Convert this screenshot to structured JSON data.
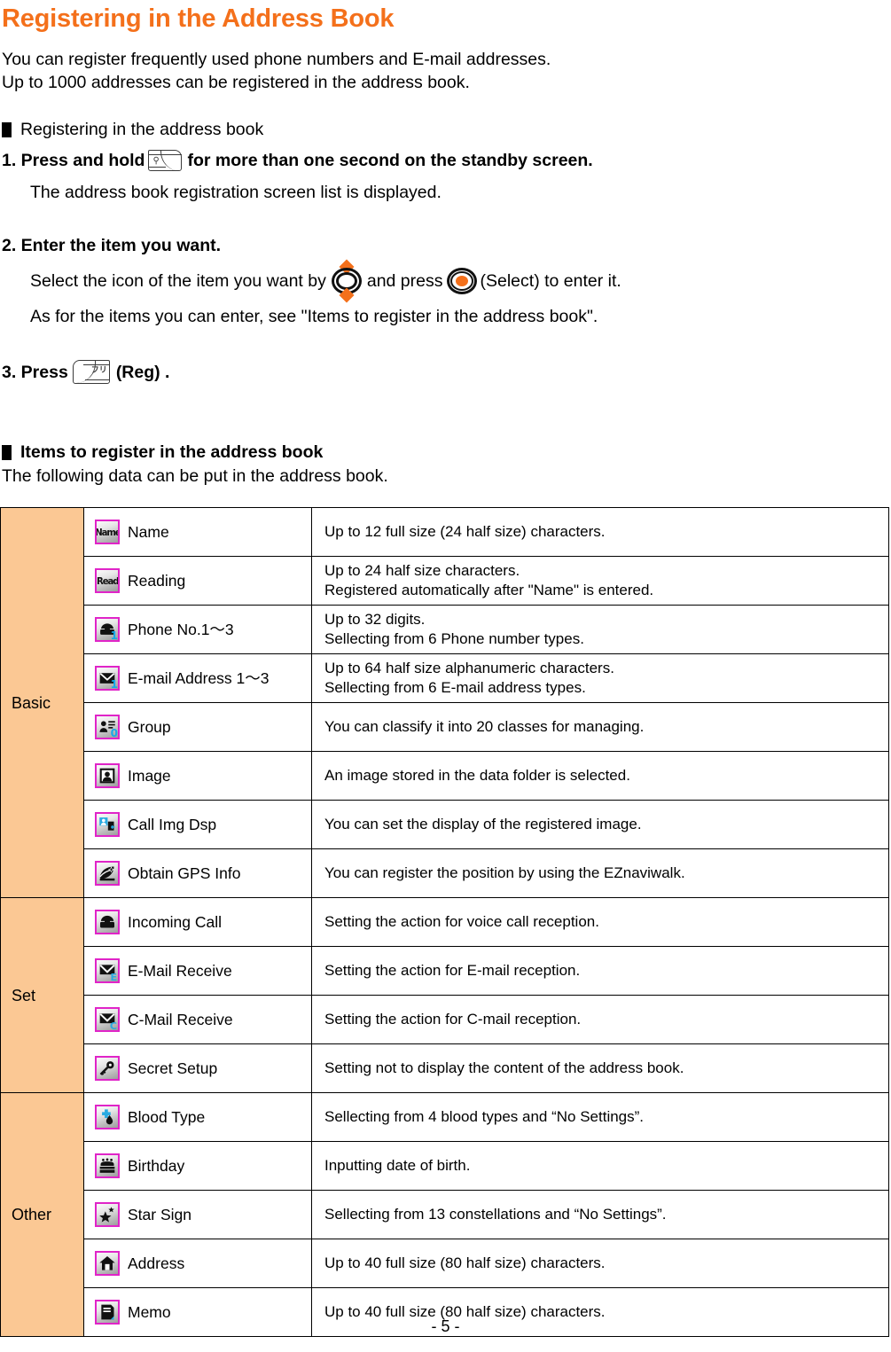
{
  "title": "Registering in the Address Book",
  "intro": {
    "line1": "You can register frequently used phone numbers and E-mail addresses.",
    "line2": "Up to 1000 addresses can be registered in the address book."
  },
  "section1": {
    "heading": "Registering in the address book",
    "step1": {
      "prefix": "1. Press and hold",
      "key_icon": "address-book-key-icon",
      "suffix": "for more than one second on the standby screen.",
      "note": "The address book registration screen list is displayed."
    },
    "step2": {
      "heading": "2. Enter the item you want.",
      "note1_a": "Select the icon of the item you want by",
      "note1_b": "and press",
      "note1_c": "(Select) to enter it.",
      "nav_icon": "navigation-key-icon",
      "select_icon": "select-key-icon",
      "note2": "As for the items you can enter, see \"Items to register in the address book\"."
    },
    "step3": {
      "prefix": "3. Press",
      "key_icon": "reg-soft-key-icon",
      "suffix": "(Reg) ."
    }
  },
  "section2": {
    "heading": "Items to register in the address book",
    "lead": "The following data can be put in the address book."
  },
  "table": {
    "accent_color": "#FBC894",
    "icon_border_color": "#E024C8",
    "groups": [
      {
        "category": "Basic",
        "rows": [
          {
            "icon": "name-text-icon",
            "icon_text": "Name",
            "label": "Name",
            "desc": [
              "Up to 12 full size (24 half size) characters."
            ]
          },
          {
            "icon": "reading-text-icon",
            "icon_text": "Read",
            "label": "Reading",
            "desc": [
              "Up to 24 half size characters.",
              "Registered automatically after \"Name\" is entered."
            ]
          },
          {
            "icon": "telephone-icon",
            "badge": "1",
            "label": "Phone No.1～3",
            "desc": [
              "Up to 32 digits.",
              "Sellecting from 6 Phone number types."
            ]
          },
          {
            "icon": "envelope-icon",
            "badge": "1",
            "label": "E-mail Address 1～3",
            "desc": [
              "Up to 64 half size alphanumeric characters.",
              "Sellecting from 6 E-mail address types."
            ]
          },
          {
            "icon": "group-person-list-icon",
            "badge": "0",
            "label": "Group",
            "desc": [
              "You can classify it into 20 classes for managing."
            ]
          },
          {
            "icon": "portrait-image-icon",
            "label": "Image",
            "desc": [
              "An image stored in the data folder is selected."
            ]
          },
          {
            "icon": "call-image-display-icon",
            "label": "Call Img Dsp",
            "desc": [
              "You can set the display of the registered image."
            ]
          },
          {
            "icon": "gps-location-icon",
            "label": "Obtain GPS Info",
            "desc": [
              "You can register the position by using the EZnaviwalk."
            ]
          }
        ]
      },
      {
        "category": "Set",
        "rows": [
          {
            "icon": "incoming-call-icon",
            "label": "Incoming Call",
            "desc": [
              "Setting the action for voice call reception."
            ]
          },
          {
            "icon": "email-receive-icon",
            "badge_letter": "E",
            "label": "E-Mail Receive",
            "desc": [
              "Setting the action for E-mail reception."
            ]
          },
          {
            "icon": "cmail-receive-icon",
            "badge_letter": "C",
            "label": "C-Mail Receive",
            "desc": [
              "Setting the action for C-mail reception."
            ]
          },
          {
            "icon": "key-secret-icon",
            "label": "Secret Setup",
            "desc": [
              "Setting not to display the content of the address book."
            ]
          }
        ]
      },
      {
        "category": "Other",
        "rows": [
          {
            "icon": "blood-drop-icon",
            "label": "Blood Type",
            "desc": [
              "Sellecting from 4 blood types and “No Settings”."
            ]
          },
          {
            "icon": "birthday-cake-icon",
            "label": "Birthday",
            "desc": [
              "Inputting date of birth."
            ]
          },
          {
            "icon": "star-sign-icon",
            "label": "Star Sign",
            "desc": [
              "Sellecting from 13 constellations and “No Settings”."
            ]
          },
          {
            "icon": "home-address-icon",
            "label": "Address",
            "desc": [
              "Up to 40 full size (80 half size) characters."
            ]
          },
          {
            "icon": "memo-note-icon",
            "label": "Memo",
            "desc": [
              "Up to 40 full size (80 half size) characters."
            ]
          }
        ]
      }
    ]
  },
  "footer": {
    "page": "- 5 -"
  }
}
